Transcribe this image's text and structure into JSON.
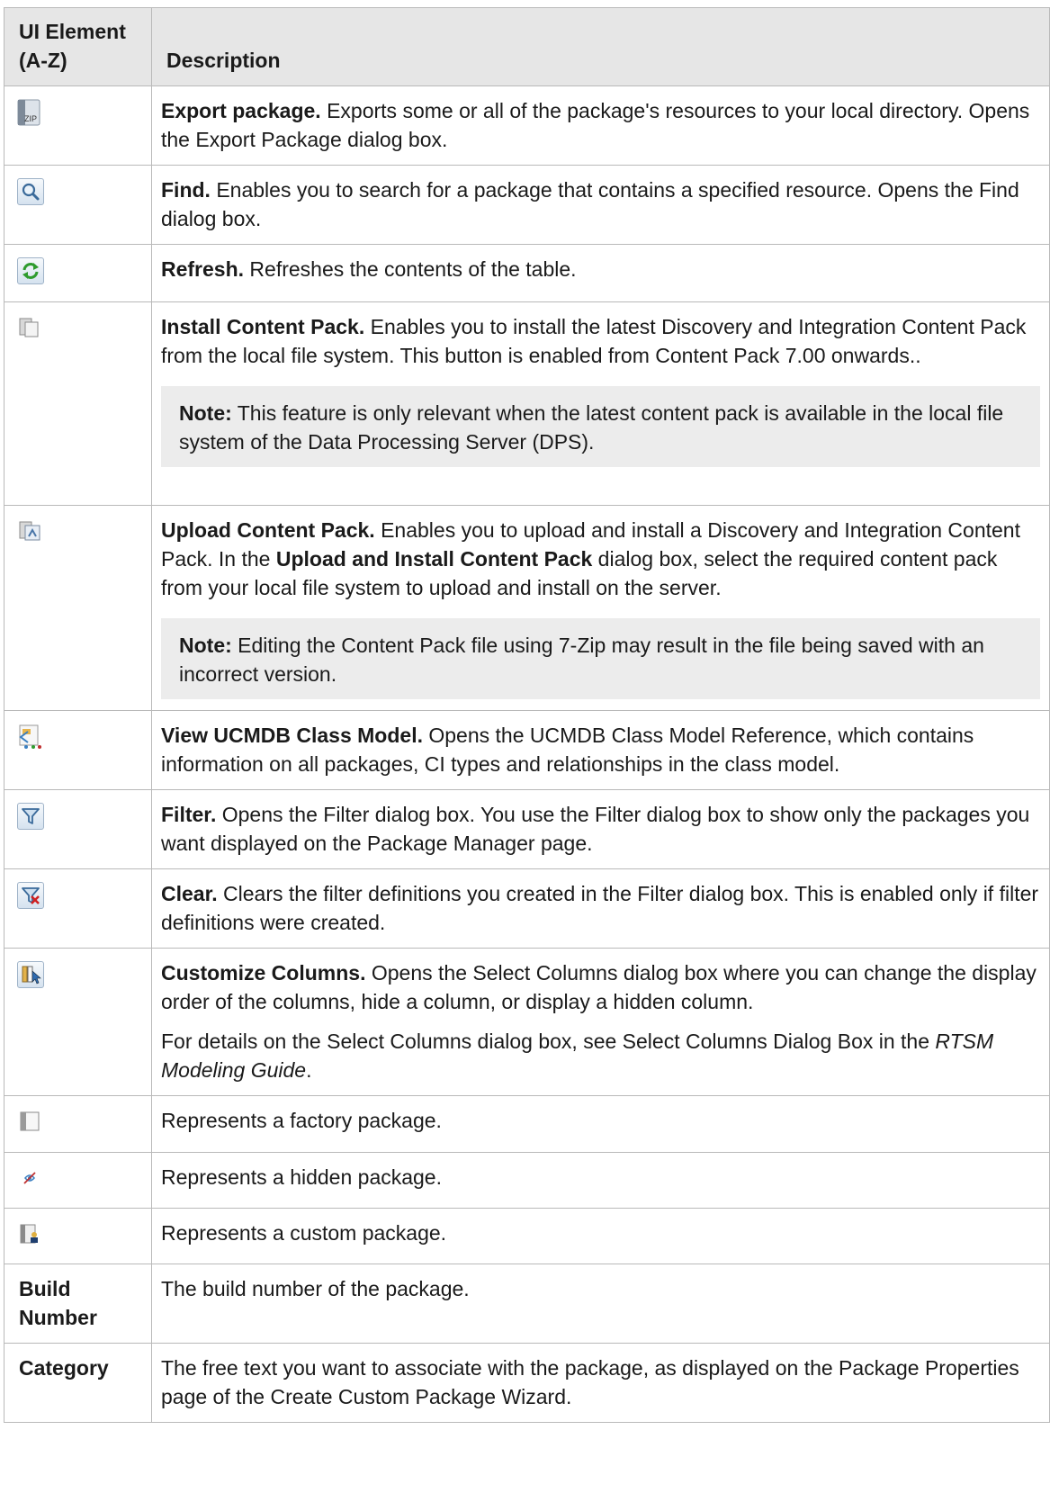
{
  "header": {
    "col1_line1": "UI Element",
    "col1_line2": "(A-Z)",
    "col2": "Description"
  },
  "rows": [
    {
      "icon": "export-zip-icon",
      "icon_text": "ZIP",
      "bold": "Export package.",
      "text": " Exports some or all of the package's resources to your local directory. Opens the Export Package dialog box."
    },
    {
      "icon": "magnifier-icon",
      "bold": "Find.",
      "text": " Enables you to search for a package that contains a specified resource. Opens the Find dialog box."
    },
    {
      "icon": "refresh-icon",
      "bold": "Refresh.",
      "text": " Refreshes the contents of the table."
    },
    {
      "icon": "install-content-pack-icon",
      "bold": "Install Content Pack.",
      "text": " Enables you to install the latest Discovery and Integration Content Pack from the local file system. This button is enabled from Content Pack 7.00 onwards..",
      "note_bold": "Note:",
      "note_text": " This feature is only relevant when the latest content pack is available in the local file system of the Data Processing Server (DPS)."
    },
    {
      "icon": "upload-content-pack-icon",
      "bold": "Upload Content Pack.",
      "text_a": " Enables you to upload and install a Discovery and Integration Content Pack. In the ",
      "bold_mid": "Upload and Install Content Pack",
      "text_b": " dialog box, select the required content pack from your local file system to upload and install on the server.",
      "note_bold": "Note:",
      "note_text": " Editing the Content Pack file using 7-Zip may result in the file being saved with an incorrect version."
    },
    {
      "icon": "class-model-icon",
      "bold": "View UCMDB Class Model.",
      "text": " Opens the UCMDB Class Model Reference, which contains information on all packages, CI types and relationships in the class model."
    },
    {
      "icon": "filter-icon",
      "bold": "Filter.",
      "text": " Opens the Filter dialog box. You use the Filter dialog box to show only the packages you want displayed on the Package Manager page."
    },
    {
      "icon": "clear-filter-icon",
      "bold": "Clear.",
      "text": " Clears the filter definitions you created in the Filter dialog box. This is enabled only if filter definitions were created."
    },
    {
      "icon": "customize-columns-icon",
      "bold": "Customize Columns.",
      "text": " Opens the Select Columns dialog box where you can change the display order of the columns, hide a column, or display a hidden column.",
      "p2_text": "For details on the Select Columns dialog box, see Select Columns Dialog Box in the ",
      "p2_italic": "RTSM Modeling Guide",
      "p2_end": "."
    },
    {
      "icon": "factory-package-icon",
      "text": "Represents a factory package."
    },
    {
      "icon": "hidden-package-icon",
      "text": "Represents a hidden package."
    },
    {
      "icon": "custom-package-icon",
      "text": "Represents a custom package."
    },
    {
      "label_line1": "Build",
      "label_line2": "Number",
      "text": "The build number of the package."
    },
    {
      "label_line1": "Category",
      "text": "The free text you want to associate with the package, as displayed on the Package Properties page of the Create Custom Package Wizard."
    }
  ],
  "colors": {
    "header_bg": "#e6e6e6",
    "note_bg": "#ececec",
    "border": "#b9b9b9",
    "refresh_green": "#2e9b2e",
    "clear_red": "#d02020"
  }
}
